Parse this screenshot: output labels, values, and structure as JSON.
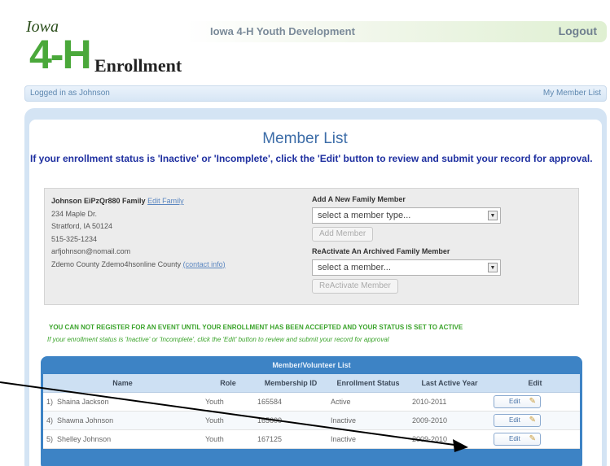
{
  "header": {
    "logo_state": "Iowa",
    "logo_mark": "4-H",
    "logo_text": "Enrollment",
    "app_title": "Iowa 4-H Youth Development",
    "logout_label": "Logout"
  },
  "statusbar": {
    "logged_in": "Logged in as Johnson",
    "my_member_list": "My Member List"
  },
  "main": {
    "title": "Member List",
    "instruction": "If your enrollment status is 'Inactive' or 'Incomplete', click the 'Edit' button to review and submit your record for approval."
  },
  "family": {
    "name": "Johnson EiPzQr880 Family",
    "edit_family_link": "Edit Family",
    "address1": "234 Maple Dr.",
    "address2": "Stratford, IA 50124",
    "phone": "515-325-1234",
    "email": "arfjohnson@nomail.com",
    "county": "Zdemo County Zdemo4hsonline County",
    "contact_info_link": "(contact info)"
  },
  "add_member": {
    "label": "Add A New Family Member",
    "select_value": "select a member type...",
    "button": "Add Member"
  },
  "reactivate": {
    "label": "ReActivate An Archived Family Member",
    "select_value": "select a member...",
    "button": "ReActivate Member"
  },
  "warnings": {
    "line1": "YOU CAN NOT REGISTER FOR AN EVENT UNTIL YOUR ENROLLMENT HAS BEEN ACCEPTED AND YOUR STATUS IS SET TO ACTIVE",
    "line2": "If your enrollment status is 'Inactive' or 'Incomplete', click the 'Edit' button to review and submit your record for approval"
  },
  "table": {
    "caption": "Member/Volunteer List",
    "headers": [
      "Name",
      "Role",
      "Membership ID",
      "Enrollment Status",
      "Last Active Year",
      "Edit"
    ],
    "rows": [
      {
        "num": "1)",
        "name": "Shaina Jackson",
        "role": "Youth",
        "id": "165584",
        "status": "Active",
        "year": "2010-2011",
        "edit": "Edit"
      },
      {
        "num": "4)",
        "name": "Shawna Johnson",
        "role": "Youth",
        "id": "165600",
        "status": "Inactive",
        "year": "2009-2010",
        "edit": "Edit"
      },
      {
        "num": "5)",
        "name": "Shelley Johnson",
        "role": "Youth",
        "id": "167125",
        "status": "Inactive",
        "year": "2009-2010",
        "edit": "Edit"
      }
    ]
  }
}
